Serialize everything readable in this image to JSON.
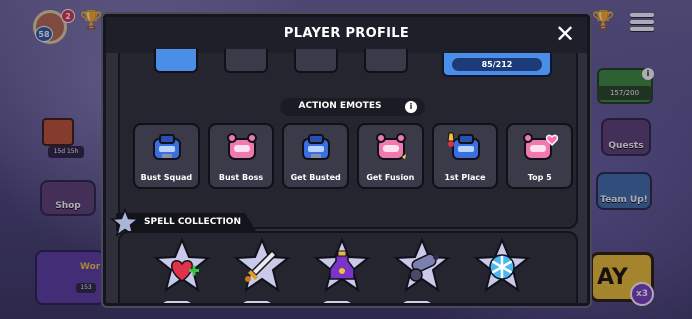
{
  "background": {
    "avatar_level": "58",
    "avatar_badge": "2",
    "chest_timer": "15d 15h",
    "shop_label": "Shop",
    "bottom_left_text": "Wor",
    "bottom_left_num": "153",
    "gem_count": "157/200",
    "gem_info": "i",
    "quests_label": "Quests",
    "teamup_label": "Team Up!",
    "play_label": "AY",
    "multiplier": "x3"
  },
  "modal": {
    "title": "PLAYER PROFILE",
    "close_icon": "close-icon",
    "progress": "85/212",
    "section_title": "ACTION EMOTES",
    "info_icon": "i",
    "emotes": [
      {
        "label": "Bust Squad",
        "art": "blue-robot"
      },
      {
        "label": "Bust Boss",
        "art": "pink-robot"
      },
      {
        "label": "Get Busted",
        "art": "blue-robot"
      },
      {
        "label": "Get Fusion",
        "art": "pink-robot"
      },
      {
        "label": "1st Place",
        "art": "blue-robot"
      },
      {
        "label": "Top 5",
        "art": "pink-robot"
      }
    ],
    "spell_title": "SPELL COLLECTION",
    "spells": [
      "heart-plus-icon",
      "sword-icon",
      "poison-bottle-icon",
      "cannon-icon",
      "snowflake-icon"
    ]
  },
  "colors": {
    "blue_robot": "#3a6fe0",
    "pink_robot": "#f07ab0",
    "progress_blue": "#4a8ee8",
    "spell_star": "#c9c9ea"
  }
}
